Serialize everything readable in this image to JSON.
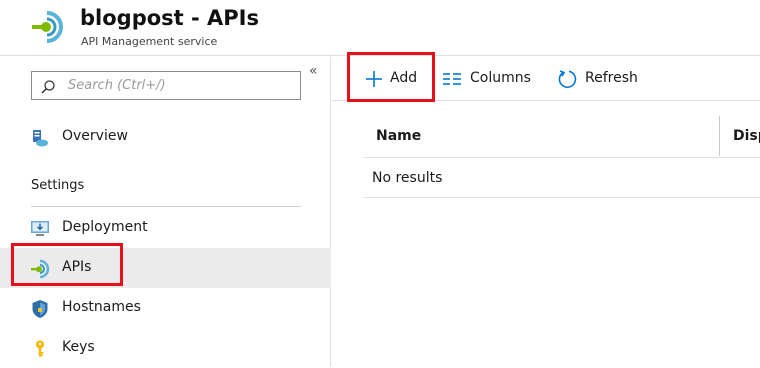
{
  "header": {
    "title": "blogpost - APIs",
    "subtitle": "API Management service",
    "logo_icon": "api-management-icon"
  },
  "sidebar": {
    "search_placeholder": "Search (Ctrl+/)",
    "collapse_glyph": "«",
    "items": [
      {
        "label": "Overview",
        "icon": "overview-icon"
      }
    ],
    "sections": [
      {
        "title": "Settings",
        "items": [
          {
            "label": "Deployment",
            "icon": "deployment-icon"
          },
          {
            "label": "APIs",
            "icon": "apis-icon",
            "selected": true
          },
          {
            "label": "Hostnames",
            "icon": "shield-icon"
          },
          {
            "label": "Keys",
            "icon": "key-icon"
          }
        ]
      }
    ]
  },
  "toolbar": {
    "add_label": "Add",
    "columns_label": "Columns",
    "refresh_label": "Refresh"
  },
  "grid": {
    "columns": [
      "Name",
      "Disp"
    ],
    "empty_text": "No results"
  },
  "colors": {
    "highlight": "#e8111a",
    "accent": "#0078d4",
    "selected_bg": "#ebebeb"
  }
}
